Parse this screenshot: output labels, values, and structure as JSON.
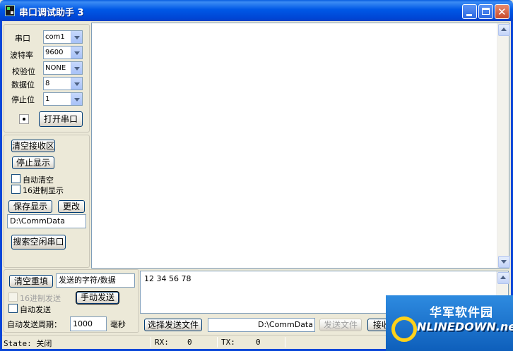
{
  "window": {
    "title": "串口调试助手 3"
  },
  "serial": {
    "port_label": "串口",
    "port_value": "com1",
    "baud_label": "波特率",
    "baud_value": "9600",
    "parity_label": "校验位",
    "parity_value": "NONE",
    "data_label": "数据位",
    "data_value": "8",
    "stop_label": "停止位",
    "stop_value": "1",
    "open_button": "打开串口"
  },
  "receive": {
    "clear_button": "清空接收区",
    "stop_button": "停止显示",
    "auto_clear_label": "自动清空",
    "hex_display_label": "16进制显示",
    "save_button": "保存显示",
    "change_button": "更改",
    "path_value": "D:\\CommData",
    "search_button": "搜索空闲串口",
    "content": ""
  },
  "send": {
    "clear_button": "清空重填",
    "title_box": "发送的字符/数据",
    "hex_send_label": "16进制发送",
    "manual_send_button": "手动发送",
    "auto_send_label": "自动发送",
    "period_label": "自动发送周期：",
    "period_value": "1000",
    "period_unit": "毫秒",
    "content": "12 34 56 78",
    "choose_file_button": "选择发送文件",
    "file_path": "D:\\CommData",
    "send_file_button": "发送文件",
    "receive_button_partial": "接收"
  },
  "status": {
    "state": "State: 关闭",
    "rx": "RX:",
    "rx_value": "0",
    "tx": "TX:",
    "tx_value": "0"
  },
  "watermark": {
    "cn": "华军软件园",
    "en": "NLINEDOWN.net"
  }
}
